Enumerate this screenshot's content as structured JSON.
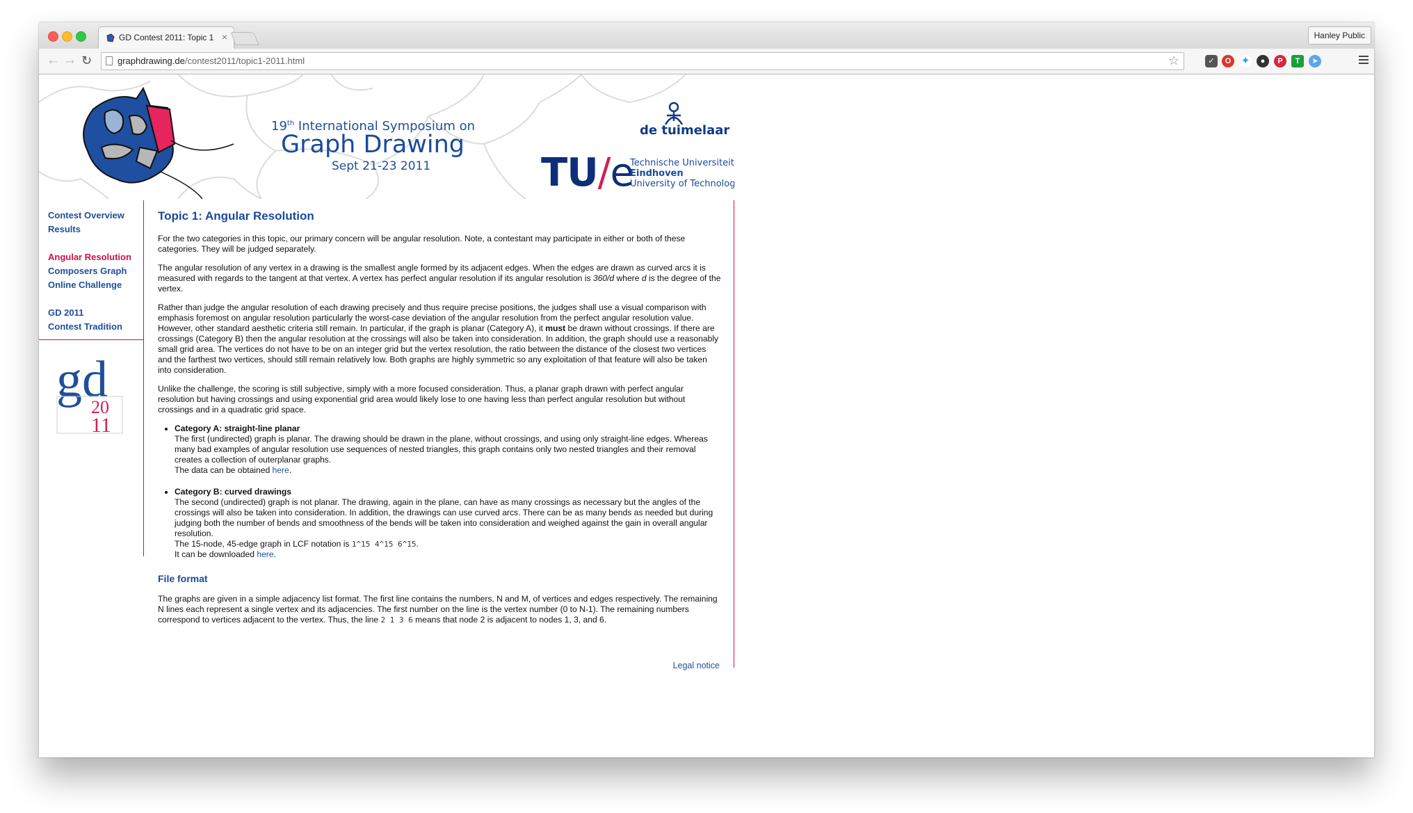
{
  "browser": {
    "tab_title": "GD Contest 2011: Topic 1",
    "tab_close": "×",
    "profile_name": "Hanley Public",
    "url_domain": "graphdrawing.de",
    "url_path": "/contest2011/topic1-2011.html"
  },
  "banner": {
    "symposium_number": "19",
    "symposium_ordinal": "th",
    "symposium_rest": " International Symposium on",
    "title": "Graph Drawing",
    "dates": "Sept 21-23 2011",
    "sponsor": "de tuimelaar",
    "tue_mark_tu": "TU",
    "tue_mark_slash": "/",
    "tue_mark_e": "e",
    "tue_line1": "Technische Universiteit",
    "tue_line2": "Eindhoven",
    "tue_line3": "University of Technology"
  },
  "sidebar": {
    "items": [
      {
        "label": "Contest Overview"
      },
      {
        "label": "Results"
      },
      {
        "label": "Angular Resolution"
      },
      {
        "label": "Composers Graph"
      },
      {
        "label": "Online Challenge"
      },
      {
        "label": "GD 2011"
      },
      {
        "label": "Contest Tradition"
      }
    ],
    "logo_gd": "gd",
    "logo_20": "20",
    "logo_11": "11"
  },
  "content": {
    "title": "Topic 1: Angular Resolution",
    "p1": "For the two categories in this topic, our primary concern will be angular resolution. Note, a contestant may participate in either or both of these categories. They will be judged separately.",
    "p2_a": "The angular resolution of any vertex in a drawing is the smallest angle formed by its adjacent edges. When the edges are drawn as curved arcs it is measured with regards to the tangent at that vertex. A vertex has perfect angular resolution if its angular resolution is ",
    "p2_formula": "360/d",
    "p2_b": " where ",
    "p2_d": "d",
    "p2_c": " is the degree of the vertex.",
    "p3_a": "Rather than judge the angular resolution of each drawing precisely and thus require precise positions, the judges shall use a visual comparison with emphasis foremost on angular resolution particularly the worst-case deviation of the angular resolution from the perfect angular resolution value. However, other standard aesthetic criteria still remain. In particular, if the graph is planar (Category A), it ",
    "p3_must": "must",
    "p3_b": " be drawn without crossings. If there are crossings (Category B) then the angular resolution at the crossings will also be taken into consideration. In addition, the graph should use a reasonably small grid area. The vertices do not have to be on an integer grid but the vertex resolution, the ratio between the distance of the closest two vertices and the farthest two vertices, should still remain relatively low. Both graphs are highly symmetric so any exploitation of that feature will also be taken into consideration.",
    "p4": "Unlike the challenge, the scoring is still subjective, simply with a more focused consideration. Thus, a planar graph drawn with perfect angular resolution but having crossings and using exponential grid area would likely lose to one having less than perfect angular resolution but without crossings and in a quadratic grid space.",
    "catA_title": "Category A: straight-line planar",
    "catA_text": "The first (undirected) graph is planar. The drawing should be drawn in the plane, without crossings, and using only straight-line edges. Whereas many bad examples of angular resolution use sequences of nested triangles, this graph contains only two nested triangles and their removal creates a collection of outerplanar graphs.",
    "catA_data_pre": "The data can be obtained ",
    "catA_link": "here",
    "catA_data_post": ".",
    "catB_title": "Category B: curved drawings",
    "catB_text": "The second (undirected) graph is not planar. The drawing, again in the plane, can have as many crossings as necessary but the angles of the crossings will also be taken into consideration. In addition, the drawings can use curved arcs. There can be as many bends as needed but during judging both the number of bends and smoothness of the bends will be taken into consideration and weighed against the gain in overall angular resolution.",
    "catB_lcf_pre": "The 15-node, 45-edge graph in LCF notation is ",
    "catB_lcf": "1^15 4^15 6^15",
    "catB_lcf_post": ".",
    "catB_dl_pre": "It can be downloaded ",
    "catB_link": "here",
    "catB_dl_post": ".",
    "fileformat_title": "File format",
    "ff_a": "The graphs are given in a simple adjacency list format. The first line contains the numbers, N and M, of vertices and edges respectively. The remaining N lines each represent a single vertex and its adjacencies. The first number on the line is the vertex number (0 to N-1). The remaining numbers correspond to vertices adjacent to the vertex. Thus, the line ",
    "ff_code": "2 1 3 6",
    "ff_b": " means that node 2 is adjacent to nodes 1, 3, and 6.",
    "legal": "Legal notice"
  }
}
